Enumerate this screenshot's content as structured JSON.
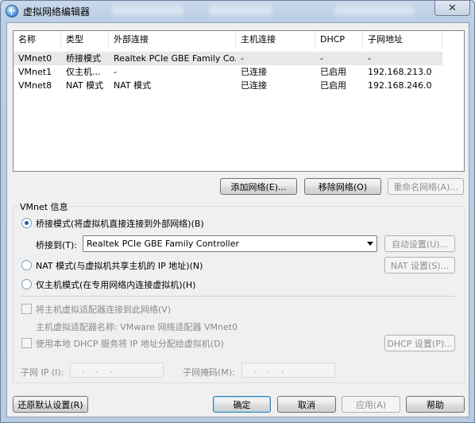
{
  "window": {
    "title": "虚拟网络编辑器",
    "close_glyph": "✕"
  },
  "network_list": {
    "columns": [
      "名称",
      "类型",
      "外部连接",
      "主机连接",
      "DHCP",
      "子网地址"
    ],
    "rows": [
      {
        "name": "VMnet0",
        "type": "桥接模式",
        "external": "Realtek PCIe GBE Family Co...",
        "host": "-",
        "dhcp": "-",
        "subnet": "-",
        "selected": true
      },
      {
        "name": "VMnet1",
        "type": "仅主机...",
        "external": "-",
        "host": "已连接",
        "dhcp": "已启用",
        "subnet": "192.168.213.0",
        "selected": false
      },
      {
        "name": "VMnet8",
        "type": "NAT 模式",
        "external": "NAT 模式",
        "host": "已连接",
        "dhcp": "已启用",
        "subnet": "192.168.246.0",
        "selected": false
      }
    ]
  },
  "list_buttons": {
    "add": "添加网络(E)...",
    "remove": "移除网络(O)",
    "rename": "重命名网络(A)..."
  },
  "vmnet_info": {
    "group_label": "VMnet 信息",
    "bridged_radio": "桥接模式(将虚拟机直接连接到外部网络)(B)",
    "bridged_to_label": "桥接到(T):",
    "bridged_to_value": "Realtek PCIe GBE Family Controller",
    "auto_settings_button": "自动设置(U)...",
    "nat_radio": "NAT 模式(与虚拟机共享主机的 IP 地址)(N)",
    "nat_settings_button": "NAT 设置(S)...",
    "hostonly_radio": "仅主机模式(在专用网络内连接虚拟机)(H)",
    "selected_mode": "bridged",
    "connect_adapter_check": "将主机虚拟适配器连接到此网络(V)",
    "adapter_name_label": "主机虚拟适配器名称: VMware 网络适配器 VMnet0",
    "dhcp_check": "使用本地 DHCP 服务将 IP 地址分配给虚拟机(D)",
    "dhcp_settings_button": "DHCP 设置(P)...",
    "subnet_ip_label": "子网 IP (I):",
    "subnet_ip_value": "...",
    "subnet_mask_label": "子网掩码(M):",
    "subnet_mask_value": "..."
  },
  "footer": {
    "restore_defaults": "还原默认设置(R)",
    "ok": "确定",
    "cancel": "取消",
    "apply": "应用(A)",
    "help": "帮助"
  }
}
